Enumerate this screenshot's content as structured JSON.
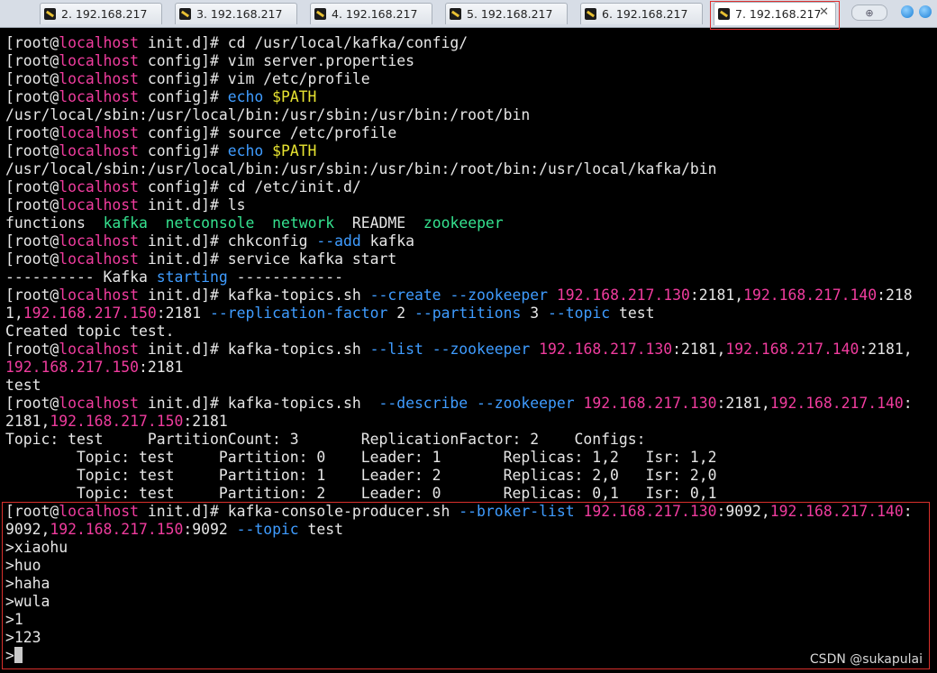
{
  "tabs": [
    {
      "label": "2. 192.168.217",
      "active": false
    },
    {
      "label": "3. 192.168.217",
      "active": false
    },
    {
      "label": "4. 192.168.217",
      "active": false
    },
    {
      "label": "5. 192.168.217",
      "active": false
    },
    {
      "label": "6. 192.168.217",
      "active": false
    },
    {
      "label": "7. 192.168.217",
      "active": true
    }
  ],
  "tab_close_glyph": "✕",
  "new_tab_glyph": "⊕",
  "terminal": {
    "lines": [
      [
        [
          "[root@",
          ""
        ],
        [
          "localhost",
          "h"
        ],
        [
          " init.d]# cd /usr/local/kafka/config/",
          ""
        ]
      ],
      [
        [
          "[root@",
          ""
        ],
        [
          "localhost",
          "h"
        ],
        [
          " config]# vim server.properties",
          ""
        ]
      ],
      [
        [
          "[root@",
          ""
        ],
        [
          "localhost",
          "h"
        ],
        [
          " config]# vim /etc/profile",
          ""
        ]
      ],
      [
        [
          "[root@",
          ""
        ],
        [
          "localhost",
          "h"
        ],
        [
          " config]# ",
          ""
        ],
        [
          "echo",
          "o"
        ],
        [
          " ",
          ""
        ],
        [
          "$PATH",
          "v"
        ]
      ],
      [
        [
          "/usr/local/sbin:/usr/local/bin:/usr/sbin:/usr/bin:/root/bin",
          ""
        ]
      ],
      [
        [
          "[root@",
          ""
        ],
        [
          "localhost",
          "h"
        ],
        [
          " config]# source /etc/profile",
          ""
        ]
      ],
      [
        [
          "[root@",
          ""
        ],
        [
          "localhost",
          "h"
        ],
        [
          " config]# ",
          ""
        ],
        [
          "echo",
          "o"
        ],
        [
          " ",
          ""
        ],
        [
          "$PATH",
          "v"
        ]
      ],
      [
        [
          "/usr/local/sbin:/usr/local/bin:/usr/sbin:/usr/bin:/root/bin:/usr/local/kafka/bin",
          ""
        ]
      ],
      [
        [
          "[root@",
          ""
        ],
        [
          "localhost",
          "h"
        ],
        [
          " config]# cd /etc/init.d/",
          ""
        ]
      ],
      [
        [
          "[root@",
          ""
        ],
        [
          "localhost",
          "h"
        ],
        [
          " init.d]# ls",
          ""
        ]
      ],
      [
        [
          "functions  ",
          ""
        ],
        [
          "kafka",
          "g"
        ],
        [
          "  ",
          ""
        ],
        [
          "netconsole",
          "g"
        ],
        [
          "  ",
          ""
        ],
        [
          "network",
          "g"
        ],
        [
          "  README  ",
          ""
        ],
        [
          "zookeeper",
          "g"
        ]
      ],
      [
        [
          "[root@",
          ""
        ],
        [
          "localhost",
          "h"
        ],
        [
          " init.d]# chkconfig ",
          ""
        ],
        [
          "--add",
          "o"
        ],
        [
          " kafka",
          ""
        ]
      ],
      [
        [
          "[root@",
          ""
        ],
        [
          "localhost",
          "h"
        ],
        [
          " init.d]# service kafka start",
          ""
        ]
      ],
      [
        [
          "---------- Kafka ",
          ""
        ],
        [
          "starting",
          "o"
        ],
        [
          " ------------",
          ""
        ]
      ],
      [
        [
          "[root@",
          ""
        ],
        [
          "localhost",
          "h"
        ],
        [
          " init.d]# kafka-topics.sh ",
          ""
        ],
        [
          "--create",
          "o"
        ],
        [
          " ",
          ""
        ],
        [
          "--zookeeper",
          "o"
        ],
        [
          " ",
          ""
        ],
        [
          "192.168.217.130",
          "n"
        ],
        [
          ":2181,",
          ""
        ],
        [
          "192.168.217.140",
          "n"
        ],
        [
          ":218",
          ""
        ]
      ],
      [
        [
          "1,",
          ""
        ],
        [
          "192.168.217.150",
          "n"
        ],
        [
          ":2181 ",
          ""
        ],
        [
          "--replication-factor",
          "o"
        ],
        [
          " 2 ",
          ""
        ],
        [
          "--partitions",
          "o"
        ],
        [
          " 3 ",
          ""
        ],
        [
          "--topic",
          "o"
        ],
        [
          " test",
          ""
        ]
      ],
      [
        [
          "Created topic test.",
          ""
        ]
      ],
      [
        [
          "[root@",
          ""
        ],
        [
          "localhost",
          "h"
        ],
        [
          " init.d]# kafka-topics.sh ",
          ""
        ],
        [
          "--list",
          "o"
        ],
        [
          " ",
          ""
        ],
        [
          "--zookeeper",
          "o"
        ],
        [
          " ",
          ""
        ],
        [
          "192.168.217.130",
          "n"
        ],
        [
          ":2181,",
          ""
        ],
        [
          "192.168.217.140",
          "n"
        ],
        [
          ":2181,",
          ""
        ]
      ],
      [
        [
          "192.168.217.150",
          "n"
        ],
        [
          ":2181",
          ""
        ]
      ],
      [
        [
          "test",
          ""
        ]
      ],
      [
        [
          "[root@",
          ""
        ],
        [
          "localhost",
          "h"
        ],
        [
          " init.d]# kafka-topics.sh  ",
          ""
        ],
        [
          "--describe",
          "o"
        ],
        [
          " ",
          ""
        ],
        [
          "--zookeeper",
          "o"
        ],
        [
          " ",
          ""
        ],
        [
          "192.168.217.130",
          "n"
        ],
        [
          ":2181,",
          ""
        ],
        [
          "192.168.217.140",
          "n"
        ],
        [
          ":",
          ""
        ]
      ],
      [
        [
          "2181,",
          ""
        ],
        [
          "192.168.217.150",
          "n"
        ],
        [
          ":2181",
          ""
        ]
      ],
      [
        [
          "Topic: test     PartitionCount: 3       ReplicationFactor: 2    Configs:",
          ""
        ]
      ],
      [
        [
          "        Topic: test     Partition: 0    Leader: 1       Replicas: 1,2   Isr: 1,2",
          ""
        ]
      ],
      [
        [
          "        Topic: test     Partition: 1    Leader: 2       Replicas: 2,0   Isr: 2,0",
          ""
        ]
      ],
      [
        [
          "        Topic: test     Partition: 2    Leader: 0       Replicas: 0,1   Isr: 0,1",
          ""
        ]
      ],
      [
        [
          "[root@",
          ""
        ],
        [
          "localhost",
          "h"
        ],
        [
          " init.d]# kafka-console-producer.sh ",
          ""
        ],
        [
          "--broker-list",
          "o"
        ],
        [
          " ",
          ""
        ],
        [
          "192.168.217.130",
          "n"
        ],
        [
          ":9092,",
          ""
        ],
        [
          "192.168.217.140",
          "n"
        ],
        [
          ":",
          ""
        ]
      ],
      [
        [
          "9092,",
          ""
        ],
        [
          "192.168.217.150",
          "n"
        ],
        [
          ":9092 ",
          ""
        ],
        [
          "--topic",
          "o"
        ],
        [
          " test",
          ""
        ]
      ],
      [
        [
          ">xiaohu",
          ""
        ]
      ],
      [
        [
          ">huo",
          ""
        ]
      ],
      [
        [
          ">haha",
          ""
        ]
      ],
      [
        [
          ">wula",
          ""
        ]
      ],
      [
        [
          ">1",
          ""
        ]
      ],
      [
        [
          ">123",
          ""
        ]
      ],
      [
        [
          ">",
          ""
        ]
      ]
    ]
  },
  "watermark": "CSDN @sukapulai"
}
